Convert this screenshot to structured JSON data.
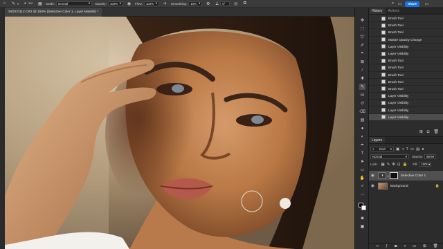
{
  "options_bar": {
    "tool_icon": "brush-icon",
    "brush_size": "300",
    "mode_label": "Mode:",
    "mode_value": "Normal",
    "opacity_label": "Opacity:",
    "opacity_value": "100%",
    "flow_label": "Flow:",
    "flow_value": "100%",
    "smoothing_label": "Smoothing:",
    "smoothing_value": "10%",
    "angle_value": "0°",
    "share_label": "Share"
  },
  "document": {
    "tab_title": "SEDC0112.CR2 @ 150% (Selective Color 1, Layer Mask/8) *"
  },
  "history_panel": {
    "tabs": [
      "History",
      "Actions"
    ],
    "active_tab": "History",
    "items": [
      "Brush Tool",
      "Brush Tool",
      "Brush Tool",
      "Master Opacity Change",
      "Layer Visibility",
      "Layer Visibility",
      "Brush Tool",
      "Brush Tool",
      "Brush Tool",
      "Brush Tool",
      "Brush Tool",
      "Layer Visibility",
      "Layer Visibility",
      "Layer Visibility",
      "Layer Visibility"
    ],
    "selected_index": 14
  },
  "layers_panel": {
    "title": "Layers",
    "filter_kind": "Kind",
    "blend_mode": "Normal",
    "opacity_label": "Opacity:",
    "opacity_value": "85%",
    "lock_label": "Lock:",
    "fill_label": "Fill:",
    "fill_value": "100%",
    "layers": [
      {
        "name": "Selective Color 1",
        "selected": true
      },
      {
        "name": "Background",
        "selected": false
      }
    ]
  },
  "colors": {
    "accent": "#1473e6",
    "panel_bg": "#2c2c2c",
    "selected_row": "#4d4d4d"
  }
}
